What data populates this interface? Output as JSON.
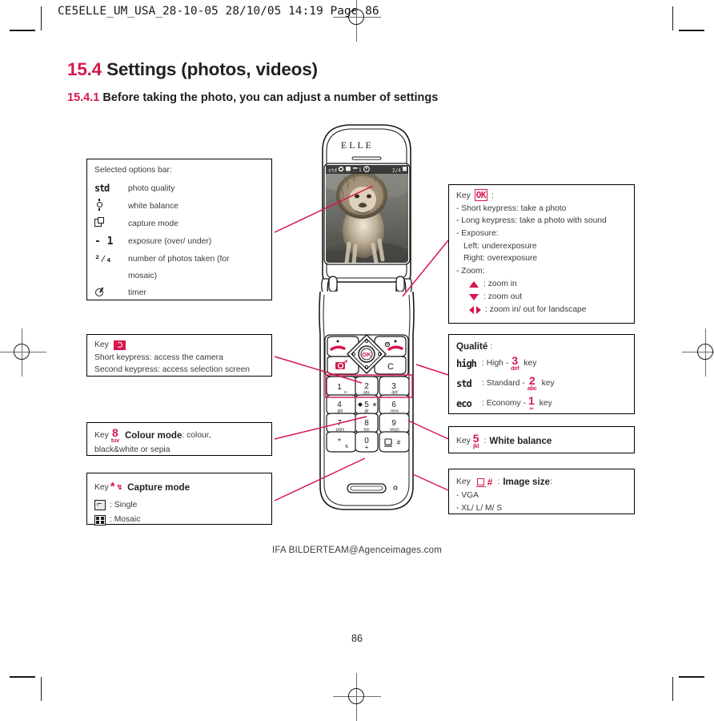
{
  "print_header": "CE5ELLE_UM_USA_28-10-05   28/10/05  14:19  Page 86",
  "headings": {
    "section_number": "15.4",
    "section_title": "Settings (photos, videos)",
    "sub_number": "15.4.1",
    "sub_title": "Before taking the photo, you can adjust a number of settings"
  },
  "options_bar_box": {
    "title": "Selected options bar:",
    "rows": [
      {
        "icon": "std-quality-icon",
        "label": "photo quality"
      },
      {
        "icon": "white-balance-icon",
        "label": "white balance"
      },
      {
        "icon": "capture-mode-icon",
        "label": "capture mode"
      },
      {
        "icon": "exposure-icon",
        "icon_text": "- 1",
        "label": "exposure (over/ under)"
      },
      {
        "icon": "photo-count-icon",
        "icon_text": "2/4",
        "label": "number of photos taken (for"
      },
      {
        "icon": "",
        "label": "mosaic)"
      },
      {
        "icon": "timer-icon",
        "label": "timer"
      }
    ]
  },
  "camera_key_box": {
    "key_label": "Key",
    "key_icon": "camera-icon",
    "lines": [
      "Short keypress: access the camera",
      "Second keypress: access selection screen"
    ]
  },
  "colour_mode_box": {
    "key_label": "Key",
    "key_digit": "8",
    "key_sub": "tuv",
    "title": "Colour mode",
    "text_after": ": colour,",
    "line2": "black&white or sepia"
  },
  "capture_mode_box": {
    "key_label": "Key",
    "key_star": "*",
    "key_sub": "↯",
    "title": "Capture mode",
    "rows": [
      {
        "icon": "single-icon",
        "label": ": Single"
      },
      {
        "icon": "mosaic-icon",
        "label": ": Mosaic"
      }
    ]
  },
  "ok_key_box": {
    "key_label": "Key",
    "key_icon": "ok-key-icon",
    "key_icon_text": "OK",
    "colon": ":",
    "lines": [
      "- Short keypress: take a photo",
      "- Long keypress: take a photo with sound",
      "- Exposure:",
      "Left: underexposure",
      "Right: overexposure",
      "- Zoom:"
    ],
    "zoom_rows": [
      {
        "icon": "arrow-up-icon",
        "label": ": zoom in"
      },
      {
        "icon": "arrow-down-icon",
        "label": ": zoom out"
      },
      {
        "icon": "arrow-left-right-icon",
        "label": ": zoom in/ out for landscape"
      }
    ]
  },
  "quality_box": {
    "title": "Qualité",
    "colon": ":",
    "rows": [
      {
        "glyph": "high",
        "label": ": High -",
        "key_digit": "3",
        "key_sub": "def",
        "key_word": "key"
      },
      {
        "glyph": "std",
        "label": ": Standard -",
        "key_digit": "2",
        "key_sub": "abc",
        "key_word": "key"
      },
      {
        "glyph": "eco",
        "label": ": Economy -",
        "key_digit": "1",
        "key_sub": "∞",
        "key_word": "key"
      }
    ]
  },
  "white_balance_box": {
    "key_label": "Key",
    "key_digit": "5",
    "key_sub": "jkl",
    "colon": ":",
    "title": "White balance"
  },
  "image_size_box": {
    "key_label": "Key",
    "key_icon": "image-size-icon",
    "key_hash": "#",
    "colon": ":",
    "title": "Image size",
    "lines": [
      "- VGA",
      "- XL/ L/ M/ S"
    ]
  },
  "phone": {
    "brand": "ELLE",
    "screen_photo_alt": "lion photograph",
    "screen_status_left": "std",
    "screen_status_right": "2/4",
    "soft_key_right": "C",
    "center_key": "OK",
    "keys": [
      {
        "digit": "1",
        "sub": "∞"
      },
      {
        "digit": "2",
        "sub": "abc"
      },
      {
        "digit": "3",
        "sub": "def"
      },
      {
        "digit": "4",
        "sub": "ghi"
      },
      {
        "digit": "5",
        "sub": "jkl"
      },
      {
        "digit": "6",
        "sub": "mno"
      },
      {
        "digit": "7",
        "sub": "pqrs"
      },
      {
        "digit": "8",
        "sub": "tuv"
      },
      {
        "digit": "9",
        "sub": "wxyz"
      },
      {
        "digit": "*",
        "sub": "↯"
      },
      {
        "digit": "0",
        "sub": "+"
      },
      {
        "digit": "#",
        "sub": ""
      }
    ]
  },
  "credit": "IFA  BILDERTEAM@Agenceimages.com",
  "page_number": "86"
}
